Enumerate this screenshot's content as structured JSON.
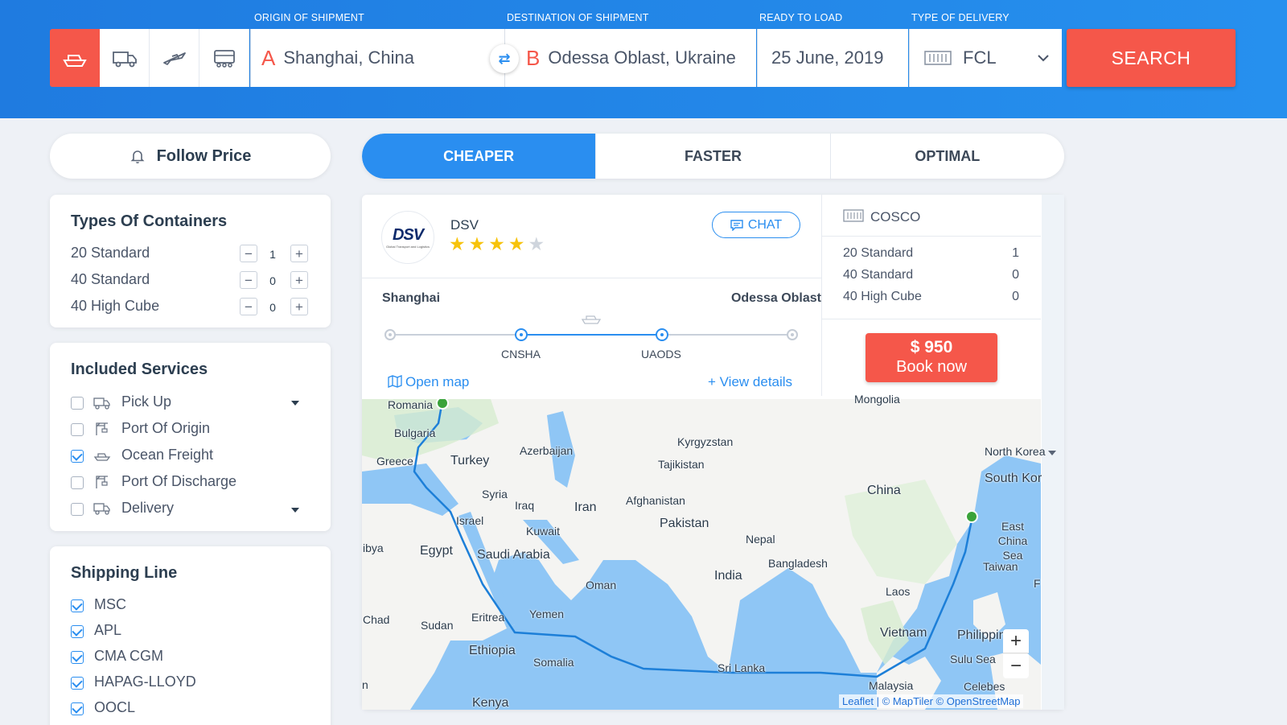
{
  "header": {
    "labels": {
      "origin": "ORIGIN OF SHIPMENT",
      "destination": "DESTINATION OF SHIPMENT",
      "ready": "READY TO LOAD",
      "delivery": "TYPE OF DELIVERY"
    },
    "origin": {
      "letter": "A",
      "value": "Shanghai, China"
    },
    "destination": {
      "letter": "B",
      "value": "Odessa Oblast, Ukraine"
    },
    "ready_date": "25 June, 2019",
    "delivery_type": "FCL",
    "search_label": "SEARCH",
    "transport_modes": [
      "ship-icon",
      "truck-icon",
      "plane-icon",
      "train-icon"
    ],
    "accent": "#f5574a",
    "brand": "#2a8ef0"
  },
  "follow_price": "Follow Price",
  "containers": {
    "title": "Types Of Containers",
    "items": [
      {
        "label": "20 Standard",
        "qty": "1"
      },
      {
        "label": "40 Standard",
        "qty": "0"
      },
      {
        "label": "40 High Cube",
        "qty": "0"
      }
    ]
  },
  "services": {
    "title": "Included Services",
    "items": [
      {
        "label": "Pick Up",
        "checked": false
      },
      {
        "label": "Port Of Origin",
        "checked": false
      },
      {
        "label": "Ocean Freight",
        "checked": true
      },
      {
        "label": "Port Of Discharge",
        "checked": false
      },
      {
        "label": "Delivery",
        "checked": false
      }
    ]
  },
  "shipping_line": {
    "title": "Shipping Line",
    "items": [
      {
        "label": "MSC",
        "checked": true
      },
      {
        "label": "APL",
        "checked": true
      },
      {
        "label": "CMA CGM",
        "checked": true
      },
      {
        "label": "HAPAG-LLOYD",
        "checked": true
      },
      {
        "label": "OOCL",
        "checked": true
      }
    ]
  },
  "tabs": [
    "CHEAPER",
    "FASTER",
    "OPTIMAL"
  ],
  "result": {
    "logo_text": "DSV",
    "logo_tagline": "Global Transport and Logistics",
    "carrier": "DSV",
    "rating": 4,
    "chat_label": "CHAT",
    "route": {
      "from": "Shanghai",
      "to": "Odessa Oblast",
      "ports": [
        "CNSHA",
        "UAODS"
      ]
    },
    "open_map": "Open map",
    "view_details": "+ View details",
    "line": "COSCO",
    "containers": [
      {
        "label": "20 Standard",
        "qty": "1"
      },
      {
        "label": "40 Standard",
        "qty": "0"
      },
      {
        "label": "40 High Cube",
        "qty": "0"
      }
    ],
    "price": "$ 950",
    "book_label": "Book now"
  },
  "map": {
    "labels": [
      "Romania",
      "Bulgaria",
      "Greece",
      "Turkey",
      "Azerbaijan",
      "Kyrgyzstan",
      "Tajikistan",
      "Mongolia",
      "North Korea",
      "South Kor",
      "China",
      "Syria",
      "Iraq",
      "Iran",
      "Afghanistan",
      "Pakistan",
      "Israel",
      "Kuwait",
      "Nepal",
      "East China Sea",
      "ibya",
      "Egypt",
      "Saudi Arabia",
      "Bangladesh",
      "Taiwan",
      "Oman",
      "India",
      "Laos",
      "Chad",
      "Sudan",
      "Eritrea",
      "Yemen",
      "Vietnam",
      "Philippin",
      "Ethiopia",
      "Somalia",
      "Sri Lanka",
      "Sulu Sea",
      "Malaysia",
      "Celebes",
      "Kenya",
      "F",
      "n"
    ],
    "attribution": "Leaflet | © MapTiler © OpenStreetMap",
    "zoom_in": "+",
    "zoom_out": "−"
  }
}
